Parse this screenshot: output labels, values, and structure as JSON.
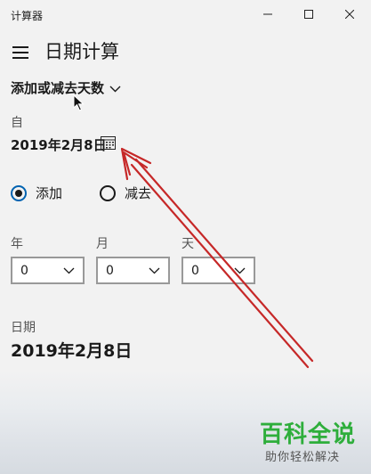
{
  "window": {
    "app_title": "计算器"
  },
  "header": {
    "page_title": "日期计算"
  },
  "mode": {
    "label": "添加或减去天数"
  },
  "from_date": {
    "label": "自",
    "value": "2019年2月8日"
  },
  "operation": {
    "add_label": "添加",
    "subtract_label": "减去",
    "selected": "添加"
  },
  "offsets": {
    "years": {
      "label": "年",
      "value": "0"
    },
    "months": {
      "label": "月",
      "value": "0"
    },
    "days": {
      "label": "天",
      "value": "0"
    }
  },
  "result": {
    "label": "日期",
    "value": "2019年2月8日"
  },
  "watermark": {
    "title": "百科全说",
    "subtitle": "助你轻松解决"
  },
  "colors": {
    "accent": "#0063b1",
    "annotation_arrow": "#c62828",
    "watermark_green": "#2eae3b"
  }
}
